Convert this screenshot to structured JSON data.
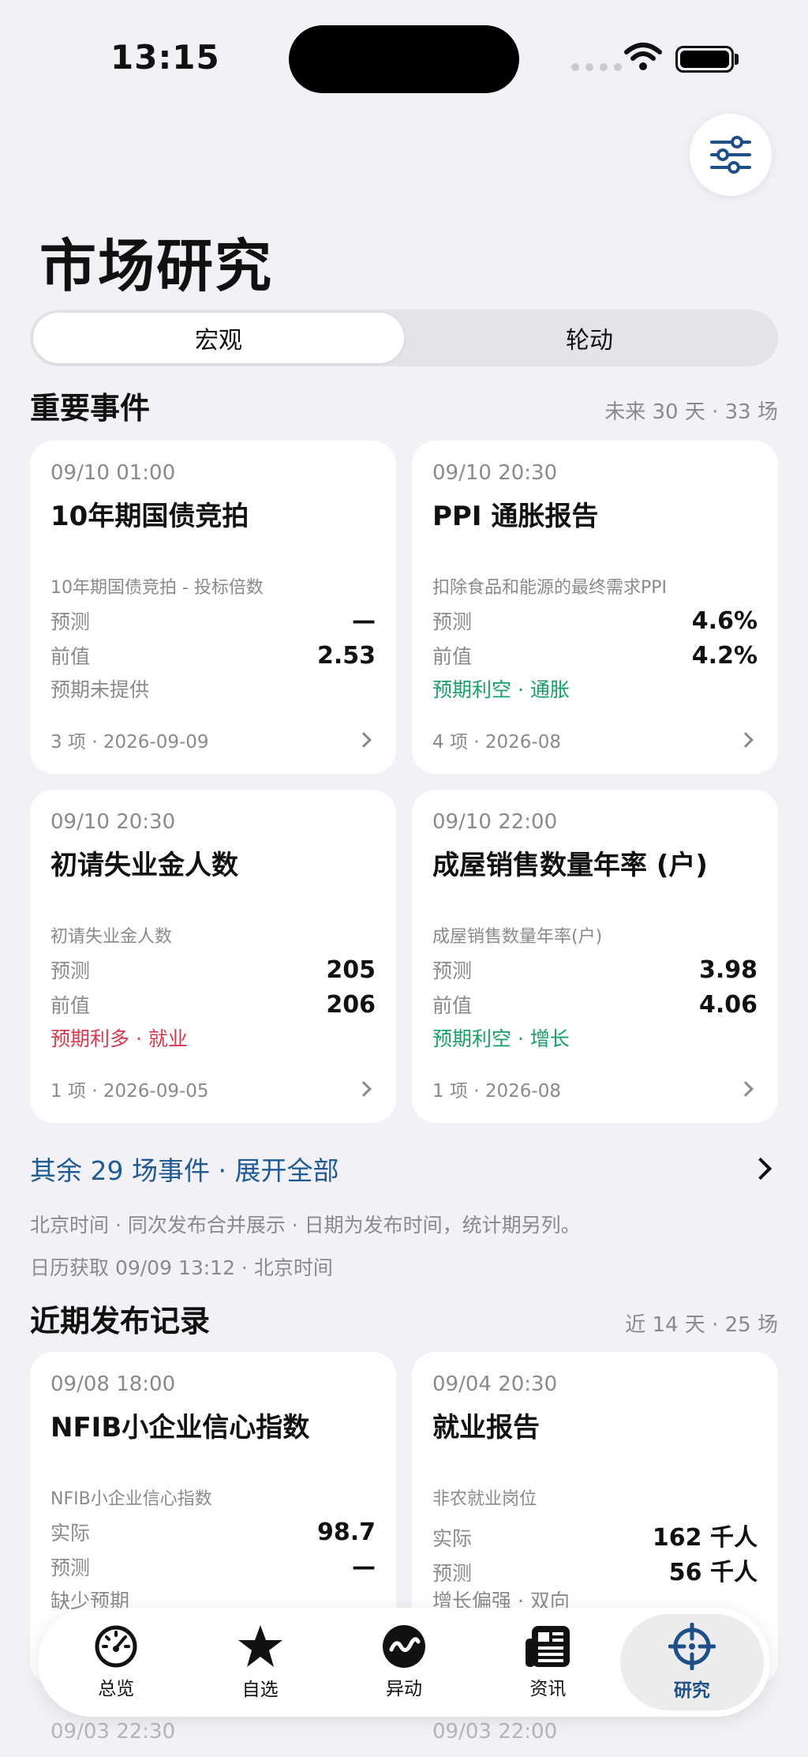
{
  "status": {
    "time": "13:15"
  },
  "header": {
    "title": "市场研究"
  },
  "segments": [
    {
      "label": "宏观",
      "active": true
    },
    {
      "label": "轮动",
      "active": false
    }
  ],
  "important": {
    "title": "重要事件",
    "meta": "未来 30 天 · 33 场",
    "cards": [
      {
        "time": "09/10 01:00",
        "title": "10年期国债竞拍",
        "sub": "10年期国债竞拍 - 投标倍数",
        "row1_label": "预测",
        "row1_value": "—",
        "row2_label": "前值",
        "row2_value": "2.53",
        "note": "预期未提供",
        "note_color": "gray",
        "foot": "3 项 · 2026-09-09"
      },
      {
        "time": "09/10 20:30",
        "title": "PPI 通胀报告",
        "sub": "扣除食品和能源的最终需求PPI",
        "row1_label": "预测",
        "row1_value": "4.6%",
        "row2_label": "前值",
        "row2_value": "4.2%",
        "note": "预期利空 · 通胀",
        "note_color": "#17a068",
        "foot": "4 项 · 2026-08"
      },
      {
        "time": "09/10 20:30",
        "title": "初请失业金人数",
        "sub": "初请失业金人数",
        "row1_label": "预测",
        "row1_value": "205",
        "row2_label": "前值",
        "row2_value": "206",
        "note": "预期利多 · 就业",
        "note_color": "#d9374e",
        "foot": "1 项 · 2026-09-05"
      },
      {
        "time": "09/10 22:00",
        "title": "成屋销售数量年率 (户)",
        "sub": "成屋销售数量年率(户)",
        "row1_label": "预测",
        "row1_value": "3.98",
        "row2_label": "前值",
        "row2_value": "4.06",
        "note": "预期利空 · 增长",
        "note_color": "#17a068",
        "foot": "1 项 · 2026-08"
      }
    ]
  },
  "expand": {
    "label": "其余 29 场事件 · 展开全部"
  },
  "info": {
    "line1": "北京时间 · 同次发布合并展示 · 日期为发布时间，统计期另列。",
    "line2": "日历获取 09/09 13:12 · 北京时间"
  },
  "recent": {
    "title": "近期发布记录",
    "meta": "近 14 天 · 25 场",
    "cards": [
      {
        "time": "09/08 18:00",
        "title": "NFIB小企业信心指数",
        "sub": "NFIB小企业信心指数",
        "row1_label": "实际",
        "row1_value": "98.7",
        "row2_label": "预测",
        "row2_value": "—",
        "note": "缺少预期"
      },
      {
        "time": "09/04 20:30",
        "title": "就业报告",
        "sub": "非农就业岗位",
        "row1_label": "实际",
        "row1_value": "162 千人",
        "row2_label": "预测",
        "row2_value": "56 千人",
        "note": "增长偏强 · 双向"
      }
    ],
    "peek_times": [
      "09/03 22:30",
      "09/03 22:00"
    ]
  },
  "tabs": [
    {
      "label": "总览",
      "icon": "gauge-icon",
      "active": false
    },
    {
      "label": "自选",
      "icon": "star-icon",
      "active": false
    },
    {
      "label": "异动",
      "icon": "wave-icon",
      "active": false
    },
    {
      "label": "资讯",
      "icon": "newspaper-icon",
      "active": false
    },
    {
      "label": "研究",
      "icon": "crosshair-icon",
      "active": true
    }
  ],
  "colors": {
    "accent": "#1e4f86",
    "link": "#1e5a94",
    "bearish": "#17a068",
    "bullish": "#d9374e",
    "background": "#f2f2f6"
  }
}
